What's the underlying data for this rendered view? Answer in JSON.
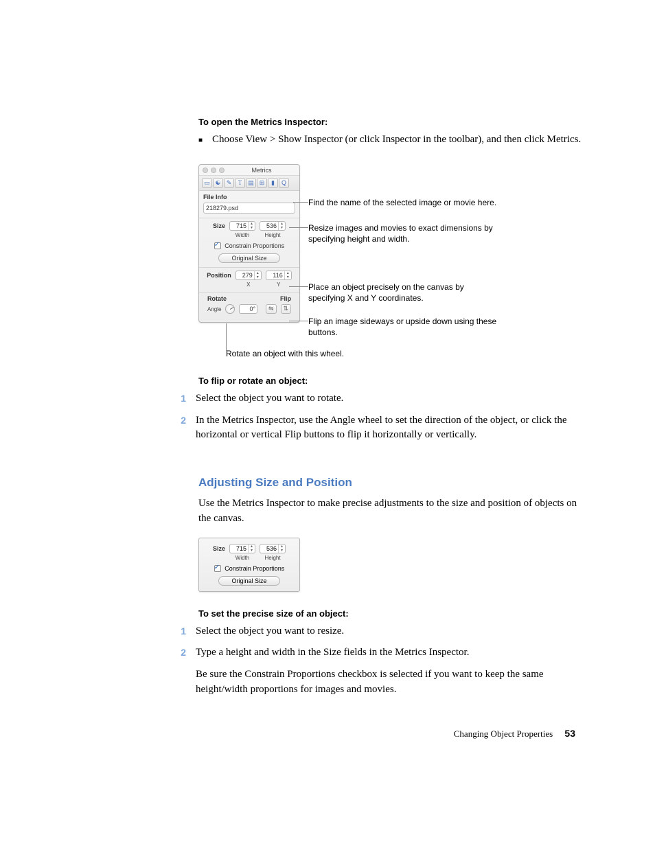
{
  "headings": {
    "open_inspector": "To open the Metrics Inspector:",
    "flip_rotate": "To flip or rotate an object:",
    "section": "Adjusting Size and Position",
    "set_size": "To set the precise size of an object:"
  },
  "intro": {
    "choose_view": "Choose View > Show Inspector (or click Inspector in the toolbar), and then click Metrics."
  },
  "inspector": {
    "title": "Metrics",
    "file_info_label": "File Info",
    "filename": "218279.psd",
    "size_label": "Size",
    "width_label": "Width",
    "height_label": "Height",
    "width_value": "715",
    "height_value": "536",
    "constrain": "Constrain Proportions",
    "original_size": "Original Size",
    "position_label": "Position",
    "x_label": "X",
    "y_label": "Y",
    "x_value": "279",
    "y_value": "116",
    "rotate_label": "Rotate",
    "flip_label": "Flip",
    "angle_label": "Angle",
    "angle_value": "0°"
  },
  "callouts": {
    "c_file": "Find the name of the selected image or movie here.",
    "c_size": "Resize images and movies to exact dimensions by specifying height and width.",
    "c_pos": "Place an object precisely on the canvas by specifying X and Y coordinates.",
    "c_flip": "Flip an image sideways or upside down using these buttons.",
    "c_rotate": "Rotate an object with this wheel."
  },
  "steps_flip": {
    "s1": "Select the object you want to rotate.",
    "s2": "In the Metrics Inspector, use the Angle wheel to set the direction of the object, or click the horizontal or vertical Flip buttons to flip it horizontally or vertically."
  },
  "body": {
    "adjust_intro": "Use the Metrics Inspector to make precise adjustments to the size and position of objects on the canvas."
  },
  "steps_size": {
    "s1": "Select the object you want to resize.",
    "s2": "Type a height and width in the Size fields in the Metrics Inspector.",
    "s2b": "Be sure the Constrain Proportions checkbox is selected if you want to keep the same height/width proportions for images and movies."
  },
  "footer": {
    "chapter": "Changing Object Properties",
    "page": "53"
  }
}
